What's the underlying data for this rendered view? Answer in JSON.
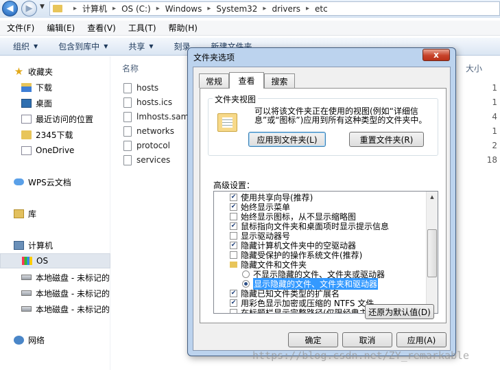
{
  "address_bar": {
    "path": [
      "计算机",
      "OS (C:)",
      "Windows",
      "System32",
      "drivers",
      "etc"
    ]
  },
  "menubar": [
    "文件(F)",
    "编辑(E)",
    "查看(V)",
    "工具(T)",
    "帮助(H)"
  ],
  "toolbar": {
    "organize": "组织",
    "include_library": "包含到库中",
    "share": "共享",
    "burn": "刻录",
    "new_folder": "新建文件夹"
  },
  "nav": {
    "favorites": "收藏夹",
    "downloads": "下载",
    "desktop": "桌面",
    "recent": "最近访问的位置",
    "download2345": "2345下载",
    "onedrive": "OneDrive",
    "wps": "WPS云文档",
    "library": "库",
    "computer": "计算机",
    "os": "OS",
    "disk1": "本地磁盘 - 未标记的",
    "disk2": "本地磁盘 - 未标记的",
    "disk3": "本地磁盘 - 未标记的",
    "network": "网络"
  },
  "files": {
    "col_name": "名称",
    "col_size": "大小",
    "rows": [
      {
        "name": "hosts",
        "size": "1"
      },
      {
        "name": "hosts.ics",
        "size": "1"
      },
      {
        "name": "lmhosts.sam",
        "size": "4"
      },
      {
        "name": "networks",
        "size": "1"
      },
      {
        "name": "protocol",
        "size": "2"
      },
      {
        "name": "services",
        "size": "18"
      }
    ]
  },
  "dialog": {
    "title": "文件夹选项",
    "close": "x",
    "tabs": [
      "常规",
      "查看",
      "搜索"
    ],
    "folder_views": {
      "title": "文件夹视图",
      "description": "可以将该文件夹正在使用的视图(例如“详细信息”或“图标”)应用到所有这种类型的文件夹中。",
      "apply_btn": "应用到文件夹(L)",
      "reset_btn": "重置文件夹(R)"
    },
    "advanced": {
      "label": "高级设置：",
      "items": [
        {
          "kind": "check",
          "checked": true,
          "text": "使用共享向导(推荐)"
        },
        {
          "kind": "check",
          "checked": true,
          "text": "始终显示菜单"
        },
        {
          "kind": "check",
          "checked": false,
          "text": "始终显示图标，从不显示缩略图"
        },
        {
          "kind": "check",
          "checked": true,
          "text": "鼠标指向文件夹和桌面项时显示提示信息"
        },
        {
          "kind": "check",
          "checked": false,
          "text": "显示驱动器号"
        },
        {
          "kind": "check",
          "checked": true,
          "text": "隐藏计算机文件夹中的空驱动器"
        },
        {
          "kind": "check",
          "checked": false,
          "text": "隐藏受保护的操作系统文件(推荐)"
        },
        {
          "kind": "folder",
          "text": "隐藏文件和文件夹"
        },
        {
          "kind": "radio",
          "on": false,
          "text": "不显示隐藏的文件、文件夹或驱动器"
        },
        {
          "kind": "radio",
          "on": true,
          "text": "显示隐藏的文件、文件夹和驱动器"
        },
        {
          "kind": "check",
          "checked": true,
          "text": "隐藏已知文件类型的扩展名"
        },
        {
          "kind": "check",
          "checked": true,
          "text": "用彩色显示加密或压缩的 NTFS 文件"
        },
        {
          "kind": "check",
          "checked": false,
          "text": "在标题栏显示完整路径(仅限经典主题)"
        }
      ]
    },
    "restore_btn": "还原为默认值(D)",
    "ok_btn": "确定",
    "cancel_btn": "取消",
    "apply_btn": "应用(A)"
  },
  "watermark": "https://blog.csdn.net/ZY_remarkable",
  "colors": {
    "selection": "#3399ff",
    "dialog_frame": "#bcd3ee"
  }
}
